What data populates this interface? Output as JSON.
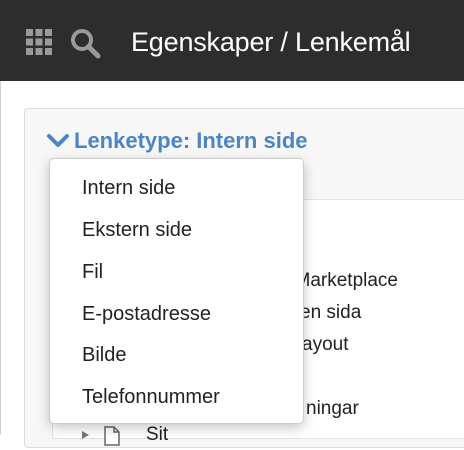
{
  "topbar": {
    "title": "Egenskaper / Lenkemål",
    "apps_icon": "grid-icon",
    "search_icon": "search-icon"
  },
  "panel": {
    "title": "Lenketype: Intern side",
    "chevron_icon": "chevron-down-icon"
  },
  "link_type_menu": {
    "options": [
      "Intern side",
      "Ekstern side",
      "Fil",
      "E-postadresse",
      "Bilde",
      "Telefonnummer"
    ],
    "selected": "Intern side"
  },
  "tree": {
    "visible_fragments": [
      "i Marketplace",
      "en sida",
      "ayout",
      "ningar",
      "Sit"
    ]
  },
  "colors": {
    "topbar_bg": "#2d2d2d",
    "accent": "#4a86c6",
    "panel_bg": "#f7f7f7"
  }
}
